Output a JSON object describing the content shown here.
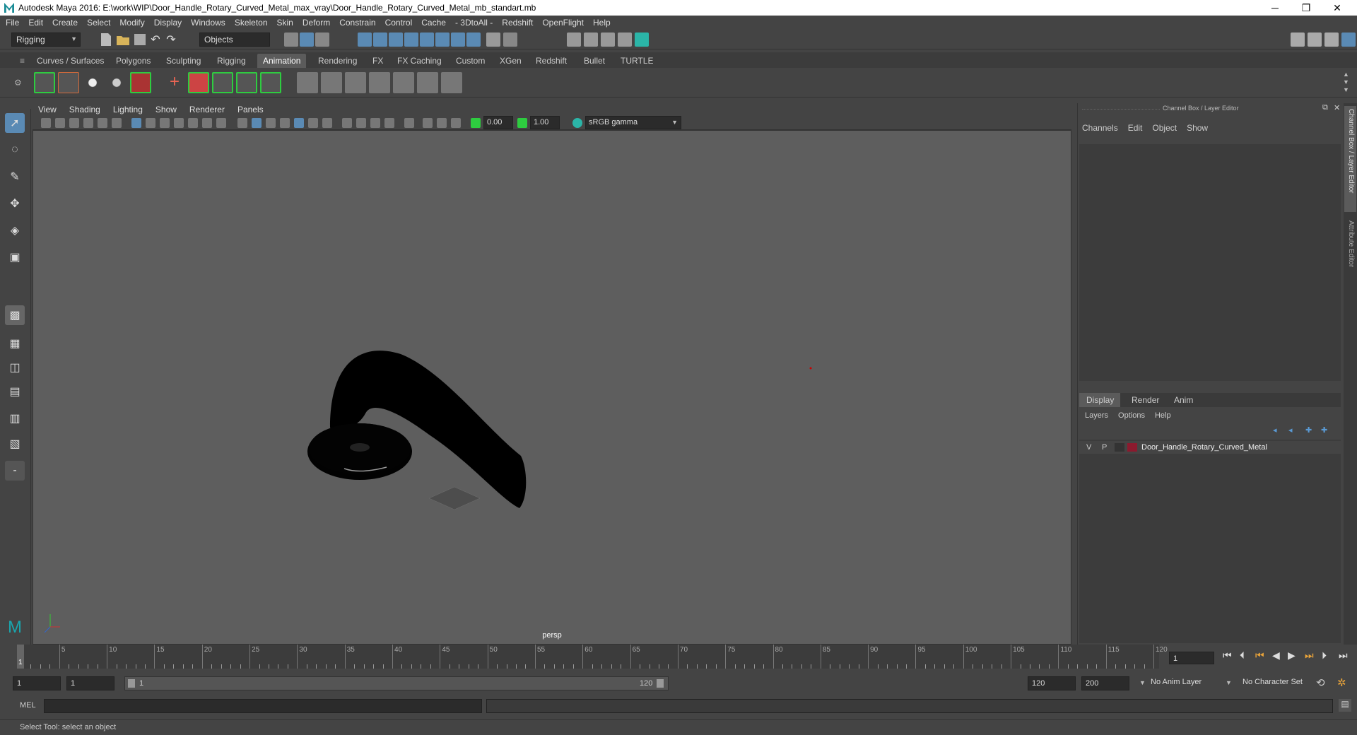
{
  "titlebar": {
    "title": "Autodesk Maya 2016: E:\\work\\WIP\\Door_Handle_Rotary_Curved_Metal_max_vray\\Door_Handle_Rotary_Curved_Metal_mb_standart.mb",
    "minimize": "─",
    "restore": "❐",
    "close": "✕"
  },
  "menubar": [
    "File",
    "Edit",
    "Create",
    "Select",
    "Modify",
    "Display",
    "Windows",
    "Skeleton",
    "Skin",
    "Deform",
    "Constrain",
    "Control",
    "Cache",
    "- 3DtoAll -",
    "Redshift",
    "OpenFlight",
    "Help"
  ],
  "toolbar": {
    "menuset": "Rigging",
    "selmode": "Objects"
  },
  "shelf_tabs": [
    "Curves / Surfaces",
    "Polygons",
    "Sculpting",
    "Rigging",
    "Animation",
    "Rendering",
    "FX",
    "FX Caching",
    "Custom",
    "XGen",
    "Redshift",
    "Bullet",
    "TURTLE"
  ],
  "active_shelf": "Animation",
  "panel_menu": [
    "View",
    "Shading",
    "Lighting",
    "Show",
    "Renderer",
    "Panels"
  ],
  "panel_tools": {
    "exposure": "0.00",
    "gamma": "1.00",
    "colorspace": "sRGB gamma"
  },
  "viewport": {
    "camera": "persp"
  },
  "channelbox": {
    "title": "Channel Box / Layer Editor",
    "menu": [
      "Channels",
      "Edit",
      "Object",
      "Show"
    ]
  },
  "layer_editor": {
    "tabs": [
      "Display",
      "Render",
      "Anim"
    ],
    "active_tab": "Display",
    "menu": [
      "Layers",
      "Options",
      "Help"
    ],
    "layers": [
      {
        "v": "V",
        "p": "P",
        "color": "#8b1a2e",
        "name": "Door_Handle_Rotary_Curved_Metal"
      }
    ]
  },
  "side_tabs": [
    "Channel Box / Layer Editor",
    "Attribute Editor"
  ],
  "timeline": {
    "start_label": "1",
    "ticks": [
      "5",
      "10",
      "15",
      "20",
      "25",
      "30",
      "35",
      "40",
      "45",
      "50",
      "55",
      "60",
      "65",
      "70",
      "75",
      "80",
      "85",
      "90",
      "95",
      "100",
      "105",
      "110",
      "115",
      "120"
    ],
    "current_frame": "1"
  },
  "range": {
    "start": "1",
    "anim_start": "1",
    "slider_start": "1",
    "slider_end": "120",
    "end": "120",
    "anim_end": "200",
    "anim_layer": "No Anim Layer",
    "char_set": "No Character Set"
  },
  "command": {
    "label": "MEL"
  },
  "help": {
    "text": "Select Tool: select an object"
  }
}
